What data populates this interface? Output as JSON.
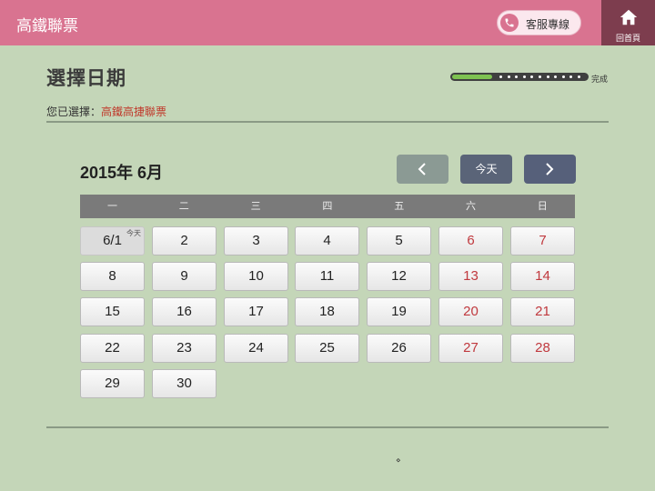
{
  "header": {
    "title": "高鐵聯票",
    "service_label": "客服專線",
    "home_label": "回首頁"
  },
  "page": {
    "title": "選擇日期",
    "progress_label": "完成",
    "progress_value": 0.3,
    "selection_prefix": "您已選擇：",
    "selection_value": "高鐵高捷聯票"
  },
  "calendar": {
    "month_label": "2015年 6月",
    "today_button": "今天",
    "today_tag": "今天",
    "weekdays": [
      "一",
      "二",
      "三",
      "四",
      "五",
      "六",
      "日"
    ],
    "days": [
      "6/1",
      "2",
      "3",
      "4",
      "5",
      "6",
      "7",
      "8",
      "9",
      "10",
      "11",
      "12",
      "13",
      "14",
      "15",
      "16",
      "17",
      "18",
      "19",
      "20",
      "21",
      "22",
      "23",
      "24",
      "25",
      "26",
      "27",
      "28",
      "29",
      "30"
    ]
  },
  "footer": {
    "mark": "⋄"
  },
  "colors": {
    "background": "#c4d6b8",
    "header": "#d97390",
    "home": "#7d3d4e",
    "weekend": "#c0393e",
    "progress": "#7ec251"
  }
}
